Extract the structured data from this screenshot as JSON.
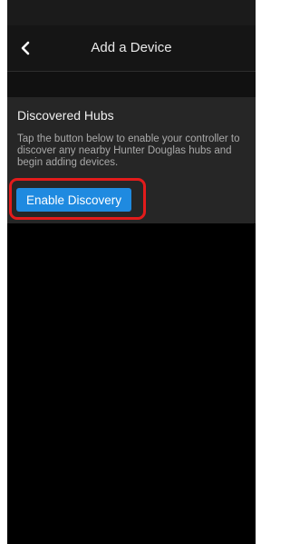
{
  "header": {
    "title": "Add a Device",
    "back_icon": "chevron-left-icon"
  },
  "hubs_card": {
    "heading": "Discovered Hubs",
    "description": "Tap the button below to enable your controller to discover any nearby Hunter Douglas hubs and begin adding devices.",
    "button_label": "Enable Discovery"
  },
  "colors": {
    "background": "#000000",
    "card": "#262626",
    "accent": "#1f8ae0",
    "highlight": "#e31b1b"
  }
}
